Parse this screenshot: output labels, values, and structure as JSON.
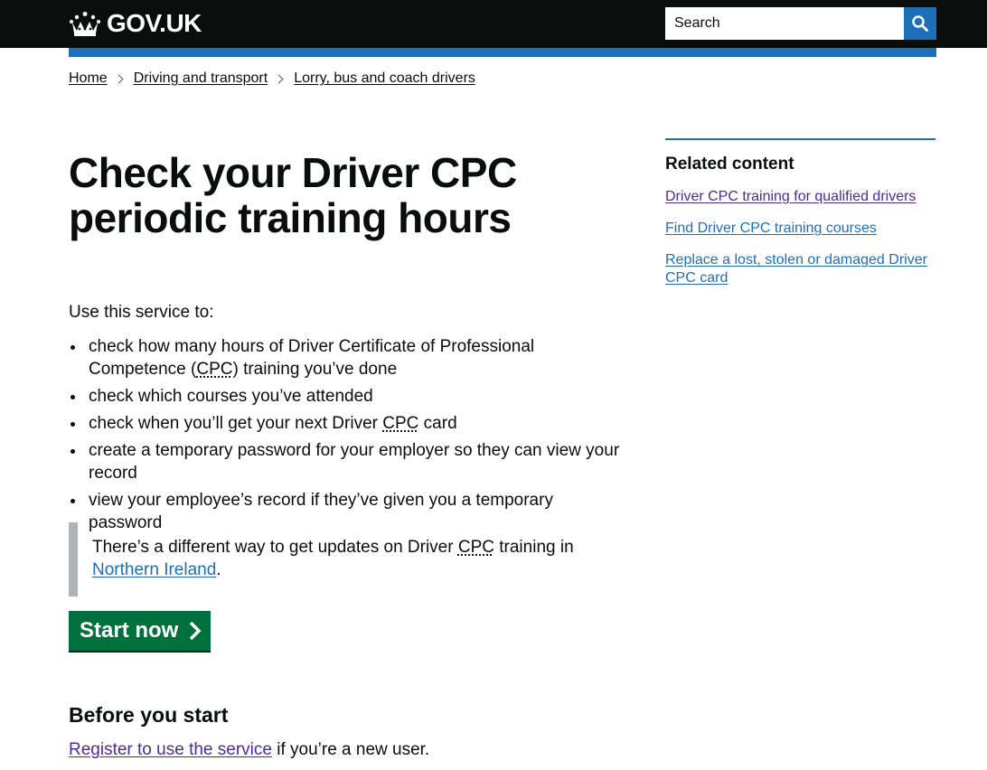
{
  "header": {
    "logo_text": "GOV.UK",
    "logo_icon": "crown-icon",
    "search": {
      "placeholder": "Search",
      "button_icon": "search-icon"
    },
    "colors": {
      "bar": "#0b0c0c",
      "accent": "#1d70b8"
    }
  },
  "breadcrumbs": [
    {
      "label": "Home"
    },
    {
      "label": "Driving and transport"
    },
    {
      "label": "Lorry, bus and coach drivers"
    }
  ],
  "main": {
    "title": "Check your Driver CPC periodic training hours",
    "intro": "Use this service to:",
    "bullets": [
      {
        "before": "check how many hours of Driver Certificate of Professional Competence (",
        "abbr": "CPC",
        "after": ") training you’ve done"
      },
      {
        "before": "check which courses you’ve attended",
        "abbr": "",
        "after": ""
      },
      {
        "before": "check when you’ll get your next Driver ",
        "abbr": "CPC",
        "after": " card"
      },
      {
        "before": "create a temporary password for your employer so they can view your record",
        "abbr": "",
        "after": ""
      },
      {
        "before": "view your employee’s record if they’ve given you a temporary password",
        "abbr": "",
        "after": ""
      }
    ],
    "inset": {
      "before": "There’s a different way to get updates on Driver ",
      "abbr": "CPC",
      "middle": " training in ",
      "link": "Northern Ireland",
      "after": "."
    },
    "start_button": {
      "label": "Start now",
      "icon": "arrow-right-icon",
      "color": "#00703c"
    },
    "before_you_start": {
      "heading": "Before you start",
      "link": "Register to use the service",
      "text_after": " if you’re a new user."
    }
  },
  "sidebar": {
    "heading": "Related content",
    "links": [
      {
        "label": "Driver CPC training for qualified drivers",
        "visited": true
      },
      {
        "label": "Find Driver CPC training courses",
        "visited": false
      },
      {
        "label": "Replace a lost, stolen or damaged Driver CPC card",
        "visited": false
      }
    ]
  }
}
